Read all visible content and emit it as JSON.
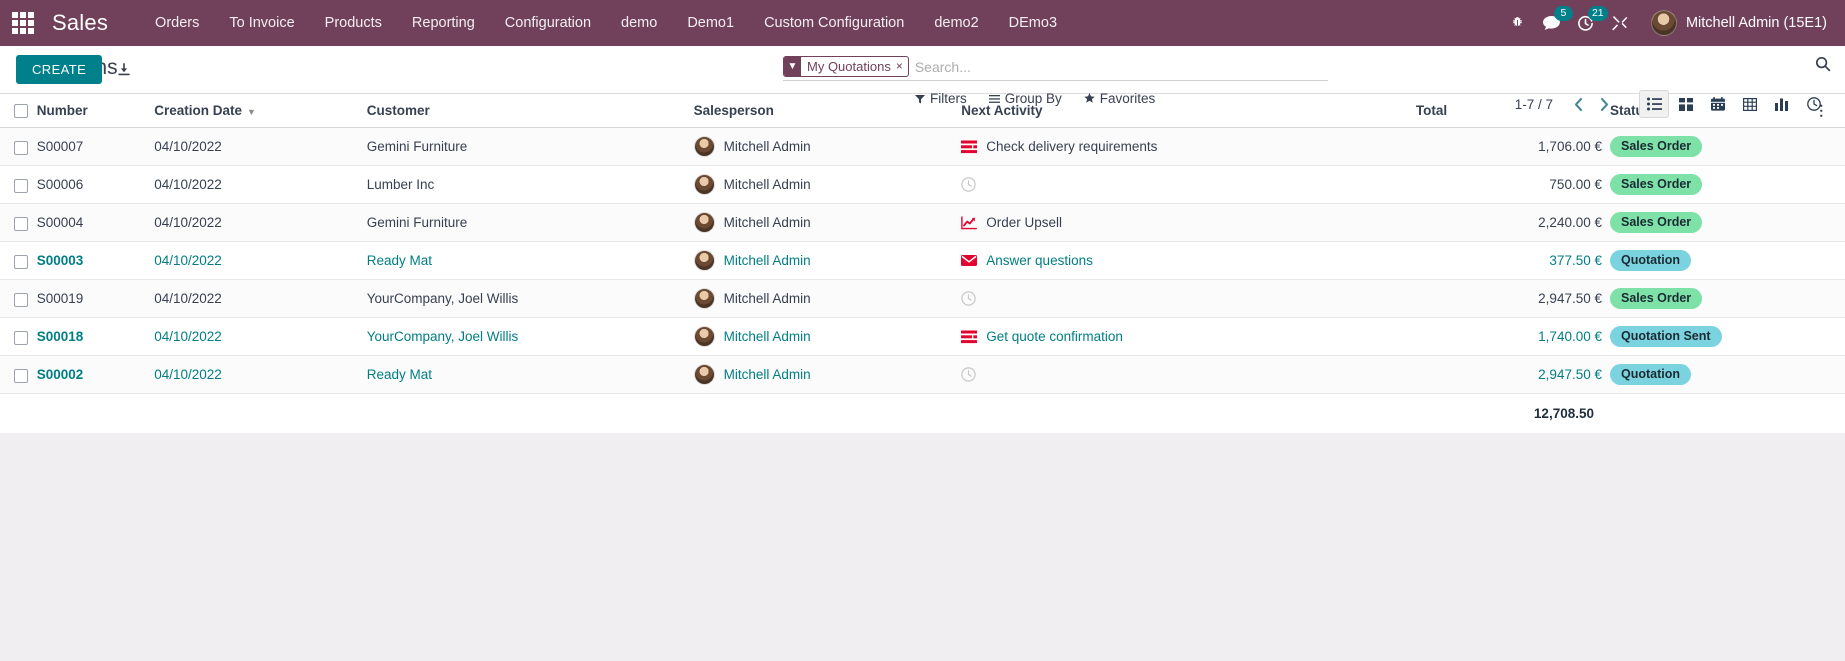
{
  "navbar": {
    "apps_icon": "apps-grid-icon",
    "brand": "Sales",
    "menu": [
      {
        "label": "Orders"
      },
      {
        "label": "To Invoice"
      },
      {
        "label": "Products"
      },
      {
        "label": "Reporting"
      },
      {
        "label": "Configuration"
      },
      {
        "label": "demo"
      },
      {
        "label": "Demo1"
      },
      {
        "label": "Custom Configuration"
      },
      {
        "label": "demo2"
      },
      {
        "label": "DEmo3"
      }
    ],
    "sys_icons": [
      {
        "name": "bug-icon",
        "badge": null
      },
      {
        "name": "messages-icon",
        "badge": "5"
      },
      {
        "name": "activities-clock-icon",
        "badge": "21"
      },
      {
        "name": "developer-tools-icon",
        "badge": null
      }
    ],
    "user_name": "Mitchell Admin (15E1)",
    "accent_color": "#71405b"
  },
  "control_panel": {
    "title": "Quotations",
    "create_label": "CREATE",
    "import_icon": "import-download-icon",
    "search": {
      "facet": {
        "label": "My Quotations",
        "icon": "filter-funnel-icon",
        "close": "×"
      },
      "placeholder": "Search..."
    },
    "filters": [
      {
        "label": "Filters",
        "icon": "funnel-icon"
      },
      {
        "label": "Group By",
        "icon": "list-lines-icon"
      },
      {
        "label": "Favorites",
        "icon": "star-icon"
      }
    ],
    "pager": {
      "text": "1-7 / 7",
      "prev": "previous-page-icon",
      "next": "next-page-icon"
    },
    "views": [
      {
        "name": "list-view",
        "icon": "list-icon",
        "active": true
      },
      {
        "name": "kanban-view",
        "icon": "kanban-icon",
        "active": false
      },
      {
        "name": "calendar-view",
        "icon": "calendar-icon",
        "active": false
      },
      {
        "name": "pivot-view",
        "icon": "pivot-table-icon",
        "active": false
      },
      {
        "name": "graph-view",
        "icon": "bar-chart-icon",
        "active": false
      },
      {
        "name": "activity-view",
        "icon": "clock-icon",
        "active": false
      }
    ],
    "search_toggle_icon": "search-icon"
  },
  "list": {
    "columns": [
      {
        "key": "number",
        "label": "Number"
      },
      {
        "key": "date",
        "label": "Creation Date",
        "sorted": "desc"
      },
      {
        "key": "customer",
        "label": "Customer"
      },
      {
        "key": "salesperson",
        "label": "Salesperson"
      },
      {
        "key": "activity",
        "label": "Next Activity"
      },
      {
        "key": "total",
        "label": "Total"
      },
      {
        "key": "status",
        "label": "Status"
      }
    ],
    "optional_columns_icon": "vertical-dots-icon",
    "rows": [
      {
        "number": "S00007",
        "date": "04/10/2022",
        "customer": "Gemini Furniture",
        "salesperson": "Mitchell Admin",
        "activity": {
          "label": "Check delivery requirements",
          "icon": "todo-list-icon",
          "color": "#e4032e"
        },
        "total": "1,706.00 €",
        "status": {
          "label": "Sales Order",
          "tone": "green"
        },
        "unread": false
      },
      {
        "number": "S00006",
        "date": "04/10/2022",
        "customer": "Lumber Inc",
        "salesperson": "Mitchell Admin",
        "activity": {
          "label": "",
          "icon": "clock-empty-icon",
          "color": "#c9c7c8"
        },
        "total": "750.00 €",
        "status": {
          "label": "Sales Order",
          "tone": "green"
        },
        "unread": false
      },
      {
        "number": "S00004",
        "date": "04/10/2022",
        "customer": "Gemini Furniture",
        "salesperson": "Mitchell Admin",
        "activity": {
          "label": "Order Upsell",
          "icon": "trend-up-icon",
          "color": "#e4032e"
        },
        "total": "2,240.00 €",
        "status": {
          "label": "Sales Order",
          "tone": "green"
        },
        "unread": false
      },
      {
        "number": "S00003",
        "date": "04/10/2022",
        "customer": "Ready Mat",
        "salesperson": "Mitchell Admin",
        "activity": {
          "label": "Answer questions",
          "icon": "envelope-icon",
          "color": "#e4032e"
        },
        "total": "377.50 €",
        "status": {
          "label": "Quotation",
          "tone": "cyan"
        },
        "unread": true
      },
      {
        "number": "S00019",
        "date": "04/10/2022",
        "customer": "YourCompany, Joel Willis",
        "salesperson": "Mitchell Admin",
        "activity": {
          "label": "",
          "icon": "clock-empty-icon",
          "color": "#c9c7c8"
        },
        "total": "2,947.50 €",
        "status": {
          "label": "Sales Order",
          "tone": "green"
        },
        "unread": false
      },
      {
        "number": "S00018",
        "date": "04/10/2022",
        "customer": "YourCompany, Joel Willis",
        "salesperson": "Mitchell Admin",
        "activity": {
          "label": "Get quote confirmation",
          "icon": "todo-list-icon",
          "color": "#e4032e"
        },
        "total": "1,740.00 €",
        "status": {
          "label": "Quotation Sent",
          "tone": "cyan"
        },
        "unread": true
      },
      {
        "number": "S00002",
        "date": "04/10/2022",
        "customer": "Ready Mat",
        "salesperson": "Mitchell Admin",
        "activity": {
          "label": "",
          "icon": "clock-empty-icon",
          "color": "#c9c7c8"
        },
        "total": "2,947.50 €",
        "status": {
          "label": "Quotation",
          "tone": "cyan"
        },
        "unread": true
      }
    ],
    "footer_total": "12,708.50"
  }
}
